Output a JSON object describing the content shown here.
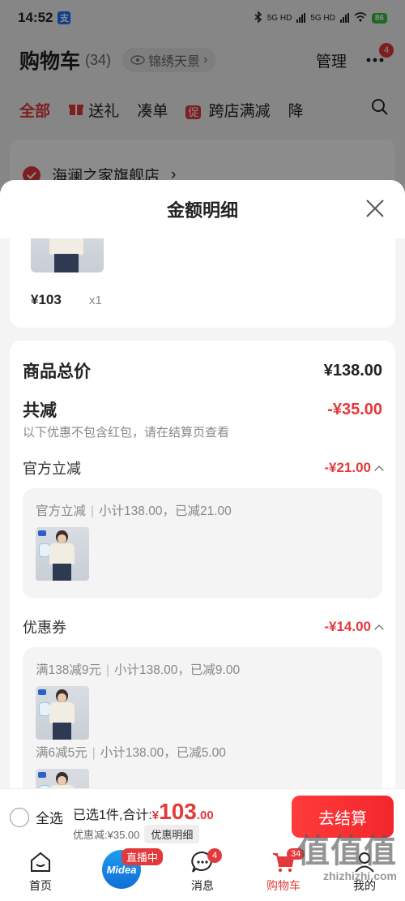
{
  "status": {
    "time": "14:52",
    "app_badge": "支",
    "net1": "5G HD",
    "net2": "5G HD",
    "battery": "86"
  },
  "header": {
    "title": "购物车",
    "count": "(34)",
    "location": "锦绣天景",
    "manage": "管理",
    "more_badge": "4"
  },
  "tabs": [
    {
      "label": "全部"
    },
    {
      "label": "送礼"
    },
    {
      "label": "凑单"
    },
    {
      "label": "跨店满减",
      "badge": "促"
    },
    {
      "label": "降"
    }
  ],
  "shop": {
    "name": "海澜之家旗舰店"
  },
  "sheet": {
    "title": "金额明细",
    "item": {
      "price": "¥103",
      "qty": "x1"
    },
    "total_label": "商品总价",
    "total_value": "¥138.00",
    "reduce_label": "共减",
    "reduce_value": "-¥35.00",
    "reduce_note": "以下优惠不包含红包，请在结算页查看",
    "official_label": "官方立减",
    "official_value": "-¥21.00",
    "official_line": {
      "name": "官方立减",
      "detail": "小计138.00，已减21.00"
    },
    "coupon_label": "优惠券",
    "coupon_value": "-¥14.00",
    "coupon_lines": [
      {
        "name": "满138减9元",
        "detail": "小计138.00，已减9.00"
      },
      {
        "name": "满6减5元",
        "detail": "小计138.00，已减5.00"
      }
    ]
  },
  "checkout": {
    "select_all": "全选",
    "selected_text": "已选1件,合计:",
    "yen": "¥",
    "amount": "103",
    "cents": ".00",
    "discount_text": "优惠减:¥35.00",
    "detail_button": "优惠明细",
    "pay_button": "去结算"
  },
  "nav": {
    "home": "首页",
    "live_logo": "Midea",
    "live_badge": "直播中",
    "messages": "消息",
    "messages_badge": "4",
    "cart": "购物车",
    "cart_badge": "34",
    "me": "我的"
  },
  "watermark": {
    "big": "值值值",
    "small": "zhizhizhi.com"
  },
  "colors": {
    "accent": "#e4393c",
    "sheet_bg": "#f4f4f4"
  }
}
